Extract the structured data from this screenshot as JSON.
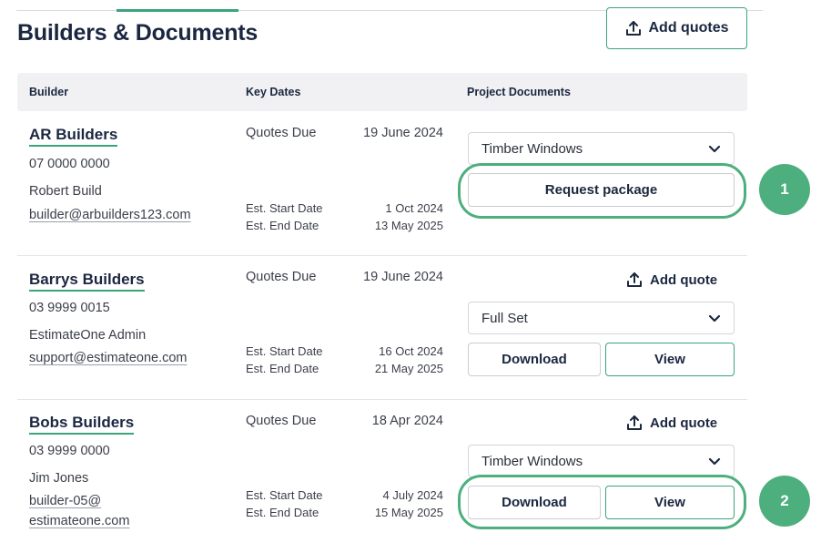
{
  "page": {
    "title": "Builders & Documents",
    "add_quotes_label": "Add quotes"
  },
  "table": {
    "headers": [
      "Builder",
      "Key Dates",
      "Project Documents"
    ]
  },
  "rows": [
    {
      "name": "AR Builders",
      "phone": "07 0000 0000",
      "contact": "Robert Build",
      "email": "builder@arbuilders123.com",
      "quotes_due_label": "Quotes Due",
      "quotes_due": "19 June 2024",
      "start_label": "Est. Start Date",
      "start_date": "1 Oct 2024",
      "end_label": "Est. End Date",
      "end_date": "13 May 2025",
      "document_select": "Timber Windows",
      "primary_action": "Request package"
    },
    {
      "name": "Barrys Builders",
      "phone": "03 9999 0015",
      "contact": "EstimateOne Admin",
      "email": "support@estimateone.com",
      "quotes_due_label": "Quotes Due",
      "quotes_due": "19 June 2024",
      "start_label": "Est. Start Date",
      "start_date": "16 Oct 2024",
      "end_label": "Est. End Date",
      "end_date": "21 May 2025",
      "add_quote_label": "Add quote",
      "document_select": "Full Set",
      "download_label": "Download",
      "view_label": "View"
    },
    {
      "name": "Bobs Builders",
      "phone": "03 9999 0000",
      "contact": "Jim Jones",
      "email_line1": "builder-05@",
      "email_line2": "estimateone.com",
      "quotes_due_label": "Quotes Due",
      "quotes_due": "18 Apr 2024",
      "start_label": "Est. Start Date",
      "start_date": "4 July 2024",
      "end_label": "Est. End Date",
      "end_date": "15 May 2025",
      "add_quote_label": "Add quote",
      "document_select": "Timber Windows",
      "download_label": "Download",
      "view_label": "View"
    }
  ],
  "markers": [
    "1",
    "2"
  ],
  "colors": {
    "accent_green": "#3aa57a",
    "marker_green": "#4caf7d",
    "heading_navy": "#1b2740",
    "header_bg": "#f1f1f3"
  },
  "icons": {
    "upload": "upload-icon",
    "dropdown": "chevron-down-icon"
  }
}
